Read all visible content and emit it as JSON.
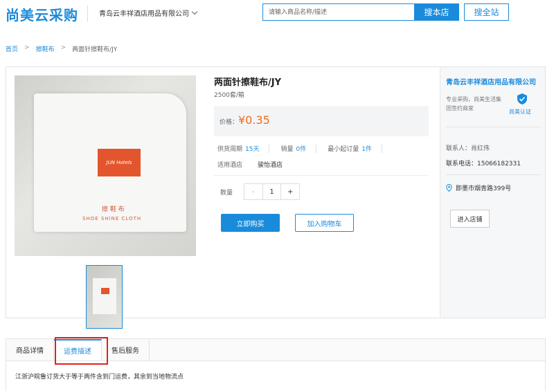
{
  "header": {
    "logo": "尚美云采购",
    "store_name": "青岛云丰祥酒店用品有限公司",
    "search_placeholder": "请输入商品名称/描述",
    "search_store_label": "搜本店",
    "search_all_label": "搜全站"
  },
  "breadcrumb": {
    "home": "首页",
    "sep": ">",
    "category": "擦鞋布",
    "current": "两面针擦鞋布/JY"
  },
  "product": {
    "title": "两面针擦鞋布/JY",
    "spec": "2500套/箱",
    "price_label": "价格：",
    "price": "¥0.35",
    "supply_label": "供货周期",
    "supply_value": "15天",
    "sales_label": "销量",
    "sales_value": "0件",
    "min_order_label": "最小起订量",
    "min_order_value": "1件",
    "hotel_label": "适用酒店",
    "hotel_value": "骏怡酒店",
    "qty_label": "数量",
    "qty_minus": "-",
    "qty_value": "1",
    "qty_plus": "+",
    "buy_label": "立即购买",
    "cart_label": "加入购物车",
    "image_text_cn": "擦 鞋 布",
    "image_text_en": "SHOE SHINE CLOTH",
    "image_logo_text": "JUN Hotels"
  },
  "seller": {
    "name": "青岛云丰祥酒店用品有限公司",
    "desc": "专业采购，尚美生活集团签约商家",
    "cert": "尚美认证",
    "contact": "联系人：肖红伟",
    "phone": "联系电话：15066182331",
    "address": "即墨市烟青路399号",
    "enter_shop": "进入店铺"
  },
  "tabs": {
    "items": [
      "商品详情",
      "运费描述",
      "售后服务"
    ],
    "active_index": 1,
    "content": "江浙沪皖鲁订货大于等于两件含到门运费，其余到当地物流点"
  },
  "colors": {
    "accent": "#1a8bdb",
    "price": "#f26b1d",
    "highlight": "#e02020"
  }
}
